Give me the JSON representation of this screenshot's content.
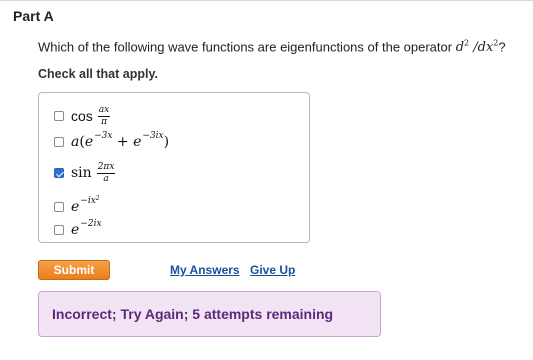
{
  "part": {
    "title": "Part A"
  },
  "question": {
    "text_before": "Which of the following wave functions are eigenfunctions of the operator ",
    "operator": "d²/dx²",
    "text_after": "?"
  },
  "instruction": "Check all that apply.",
  "choices": [
    {
      "label": "cos(ax/π)",
      "checked": false
    },
    {
      "label": "a(e^(-3x) + e^(-3ix))",
      "checked": false
    },
    {
      "label": "sin(2πx/a)",
      "checked": true
    },
    {
      "label": "e^(-ix²)",
      "checked": false
    },
    {
      "label": "e^(-2ix)",
      "checked": false
    }
  ],
  "buttons": {
    "submit": "Submit"
  },
  "links": {
    "my_answers": "My Answers",
    "give_up": "Give Up"
  },
  "feedback": {
    "text": "Incorrect; Try Again; 5 attempts remaining",
    "color": "#5b2a7a",
    "background": "#f2e4f5"
  },
  "colors": {
    "submit": "#ea7f1c",
    "checkbox_checked": "#2f6fd6",
    "link": "#1a4f9c"
  }
}
